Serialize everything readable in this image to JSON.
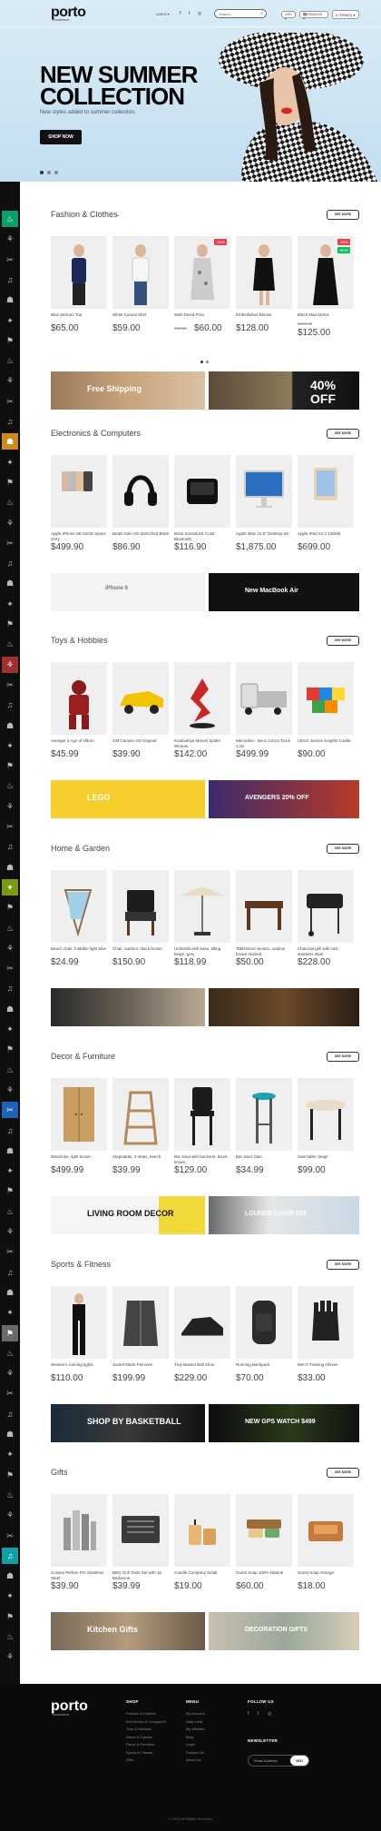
{
  "header": {
    "logo": "porto",
    "logo_sub": "ecommerce",
    "links": "LINKS ▾",
    "search_placeholder": "Search...",
    "currency": "USD ▾",
    "language": "🇬🇧 ENGLISH ▾",
    "cart": "0 ITEM(S) ▾"
  },
  "hero": {
    "title_line1": "NEW SUMMER",
    "title_line2": "COLLECTION",
    "subtitle": "New styles added to summer collection.",
    "button": "SHOP NOW"
  },
  "see_more": "SEE MORE",
  "sections": [
    {
      "title": "Fashion & Clothes",
      "products": [
        {
          "name": "Blue Women Top",
          "price": "$65.00"
        },
        {
          "name": "White Casual Shirt",
          "price": "$59.00"
        },
        {
          "name": "Multi Dived Print",
          "old": "$70.00",
          "price": "$60.00",
          "badge": "-20%"
        },
        {
          "name": "Embellished Blouse",
          "price": "$128.00"
        },
        {
          "name": "Black Maxi Dress",
          "old": "$156.00",
          "price": "$125.00",
          "badge": "-20%",
          "badge2": "NEW"
        }
      ],
      "banner1": "Free Shipping",
      "banner2": "40% OFF"
    },
    {
      "title": "Electronics & Computers",
      "products": [
        {
          "name": "Apple iPhone SE 64GB Space Grey",
          "price": "$499.90"
        },
        {
          "name": "Beats Solo HD Drenched Black",
          "price": "$86.90"
        },
        {
          "name": "Bose SoundLink Color Bluetooth",
          "price": "$116.90"
        },
        {
          "name": "Apple iMac 21.5\" Desktop 4K",
          "price": "$1,875.00"
        },
        {
          "name": "Apple iPad Air 2 128GB",
          "price": "$699.00"
        }
      ],
      "banner1": "iPhone 6",
      "banner2": "New MacBook Air"
    },
    {
      "title": "Toys & Hobbies",
      "products": [
        {
          "name": "Avenger 2 Age of Ultron",
          "price": "$45.99"
        },
        {
          "name": "GM Camaro SS Original",
          "price": "$39.90"
        },
        {
          "name": "Kotobukiya Marvel Spider Woman",
          "price": "$142.00"
        },
        {
          "name": "Mercedes - Benz Actros Truck 1:18",
          "price": "$499.99"
        },
        {
          "name": "LEGO Juniors Knights Castle",
          "price": "$90.00"
        }
      ],
      "banner1": "LEGO",
      "banner2": "AVENGERS 20% OFF"
    },
    {
      "title": "Home & Garden",
      "products": [
        {
          "name": "Beach chair, foldable light blue",
          "price": "$24.99"
        },
        {
          "name": "Chair, outdoor, black-brown",
          "price": "$150.90"
        },
        {
          "name": "Umbrella with base, tilting beige, grey",
          "price": "$118.99"
        },
        {
          "name": "Table/stool section, outdoor brown-stained",
          "price": "$50.00"
        },
        {
          "name": "Charcoal grill with cart, stainless steel",
          "price": "$228.00"
        }
      ],
      "banner1": "",
      "banner2": ""
    },
    {
      "title": "Decor & Furniture",
      "products": [
        {
          "name": "Wardrobe, light brown",
          "price": "$499.99"
        },
        {
          "name": "Stepladder, 3 steps, beech",
          "price": "$39.99"
        },
        {
          "name": "Bar stool with backrest, black-brown",
          "price": "$129.00"
        },
        {
          "name": "Bar stool, blue",
          "price": "$34.99"
        },
        {
          "name": "Side table, beige",
          "price": "$99.00"
        }
      ],
      "banner1": "LIVING ROOM DECOR",
      "banner2": "LOUNGE CHAIR $39"
    },
    {
      "title": "Sports & Fitness",
      "products": [
        {
          "name": "Women's running tights",
          "price": "$110.00"
        },
        {
          "name": "Jacket Marle Pinnover",
          "price": "$199.99"
        },
        {
          "name": "Trey Basket Ball Shoe",
          "price": "$229.00"
        },
        {
          "name": "Running Backpack",
          "price": "$70.00"
        },
        {
          "name": "Men's Training Gloves",
          "price": "$33.00"
        }
      ],
      "banner1": "SHOP BY BASKETBALL",
      "banner2": "NEW GPS WATCH $499"
    },
    {
      "title": "Gifts",
      "products": [
        {
          "name": "Cuisine Piéfore Pro Stainless Steel",
          "price": "$39.90"
        },
        {
          "name": "BBQ Grill Tools Set with 16 Barbecue",
          "price": "$39.99"
        },
        {
          "name": "Candle Company Small",
          "price": "$19.00"
        },
        {
          "name": "Guest Soap 100% Natural",
          "price": "$60.00"
        },
        {
          "name": "Guest Soap Orange",
          "price": "$18.00"
        }
      ],
      "banner1": "Kitchen Gifts",
      "banner2": "DECORATION GIFTS"
    }
  ],
  "footer": {
    "logo": "porto",
    "logo_sub": "ecommerce",
    "shop_h": "SHOP",
    "shop_links": [
      "Fashion & Clothes",
      "Electronics & Computers",
      "Toys & Hobbies",
      "Home & Garden",
      "Decor & Furniture",
      "Sports & Fitness",
      "Gifts"
    ],
    "menu_h": "MENU",
    "menu_links": [
      "My Account",
      "Daily Deal",
      "My Wishlist",
      "Blog",
      "Login",
      "Contact Us",
      "About Us"
    ],
    "follow_h": "FOLLOW US",
    "news_h": "NEWSLETTER",
    "news_placeholder": "Email Address",
    "news_btn": "GO!",
    "copyright": "© 2016 All Rights Reserved"
  },
  "colors": {
    "hero_bg": "#c9e2f2",
    "strip_bg": "#0f0f0f",
    "badge_sale": "#e2444c",
    "badge_new": "#0abf5a"
  }
}
